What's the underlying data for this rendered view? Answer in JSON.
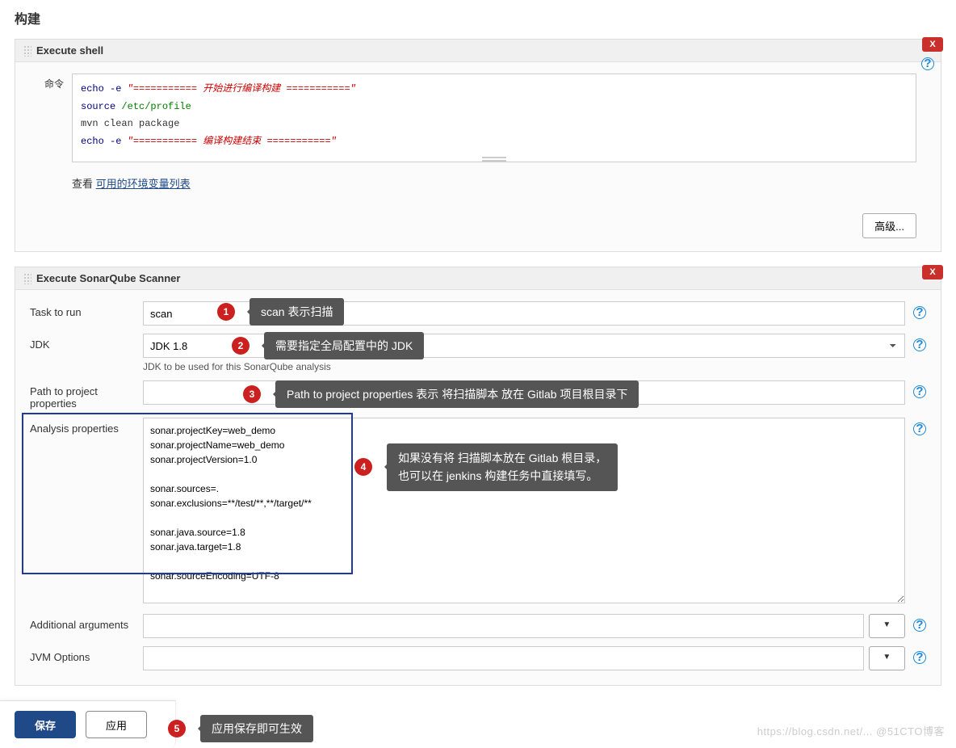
{
  "page_title": "构建",
  "shell_section": {
    "title": "Execute shell",
    "label": "命令",
    "lines": [
      {
        "type": "str",
        "kw": "echo",
        "op": "-e",
        "text": "\"=========== 开始进行编译构建 ===========\""
      },
      {
        "type": "path",
        "kw": "source",
        "text": "/etc/profile"
      },
      {
        "type": "plain",
        "text": "mvn clean package"
      },
      {
        "type": "str",
        "kw": "echo",
        "op": "-e",
        "text": "\"=========== 编译构建结束 ===========\""
      }
    ],
    "env_prefix": "查看",
    "env_link": "可用的环境变量列表",
    "adv_button": "高级..."
  },
  "sonar_section": {
    "title": "Execute SonarQube Scanner",
    "rows": {
      "task": {
        "label": "Task to run",
        "value": "scan"
      },
      "jdk": {
        "label": "JDK",
        "value": "JDK 1.8",
        "hint": "JDK to be used for this SonarQube analysis"
      },
      "path": {
        "label": "Path to project properties",
        "value": ""
      },
      "analysis": {
        "label": "Analysis properties",
        "value": "sonar.projectKey=web_demo\nsonar.projectName=web_demo\nsonar.projectVersion=1.0\n\nsonar.sources=.\nsonar.exclusions=**/test/**,**/target/**\n\nsonar.java.source=1.8\nsonar.java.target=1.8\n\nsonar.sourceEncoding=UTF-8"
      },
      "additional": {
        "label": "Additional arguments",
        "value": ""
      },
      "jvm": {
        "label": "JVM Options",
        "value": ""
      }
    }
  },
  "callouts": {
    "c1": "scan 表示扫描",
    "c2": "需要指定全局配置中的 JDK",
    "c3": "Path to project properties 表示 将扫描脚本 放在 Gitlab 项目根目录下",
    "c4": "如果没有将 扫描脚本放在 Gitlab 根目录，\n也可以在 jenkins 构建任务中直接填写。",
    "c5": "应用保存即可生效"
  },
  "buttons": {
    "save": "保存",
    "apply": "应用"
  },
  "watermark": "https://blog.csdn.net/... @51CTO博客"
}
